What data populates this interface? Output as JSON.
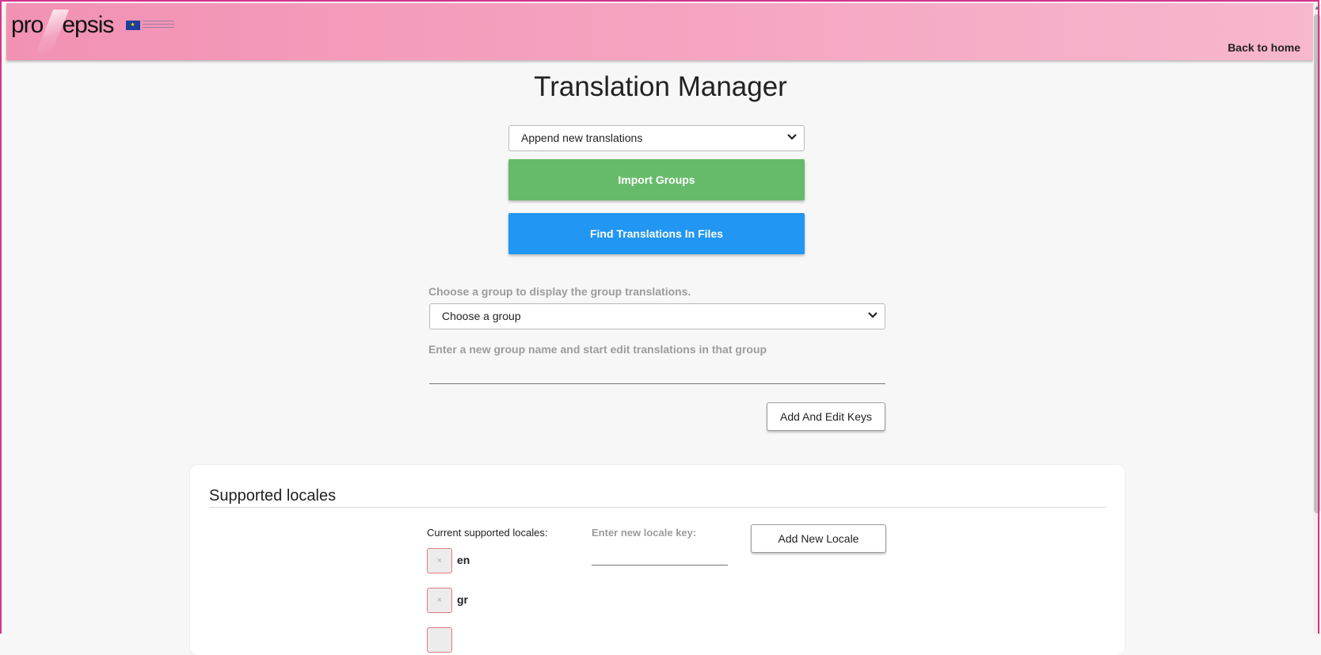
{
  "header": {
    "logo_left": "pro",
    "logo_right": "epsis",
    "back_home": "Back to home"
  },
  "page": {
    "title": "Translation Manager"
  },
  "import_mode": {
    "selected": "Append new translations"
  },
  "buttons": {
    "import_groups": "Import Groups",
    "find_translations": "Find Translations In Files",
    "add_and_edit_keys": "Add And Edit Keys",
    "add_new_locale": "Add New Locale"
  },
  "group": {
    "choose_label": "Choose a group to display the group translations.",
    "selected": "Choose a group",
    "new_group_label": "Enter a new group name and start edit translations in that group",
    "new_group_value": ""
  },
  "locales_card": {
    "title": "Supported locales",
    "current_label": "Current supported locales:",
    "new_key_label": "Enter new locale key:",
    "new_key_value": "",
    "remove_symbol": "×",
    "locales": [
      "en",
      "gr"
    ]
  },
  "colors": {
    "import_green": "#66bb6a",
    "find_blue": "#2196f3",
    "header_pink": "#f291b3",
    "frame_magenta": "#d6338a"
  }
}
